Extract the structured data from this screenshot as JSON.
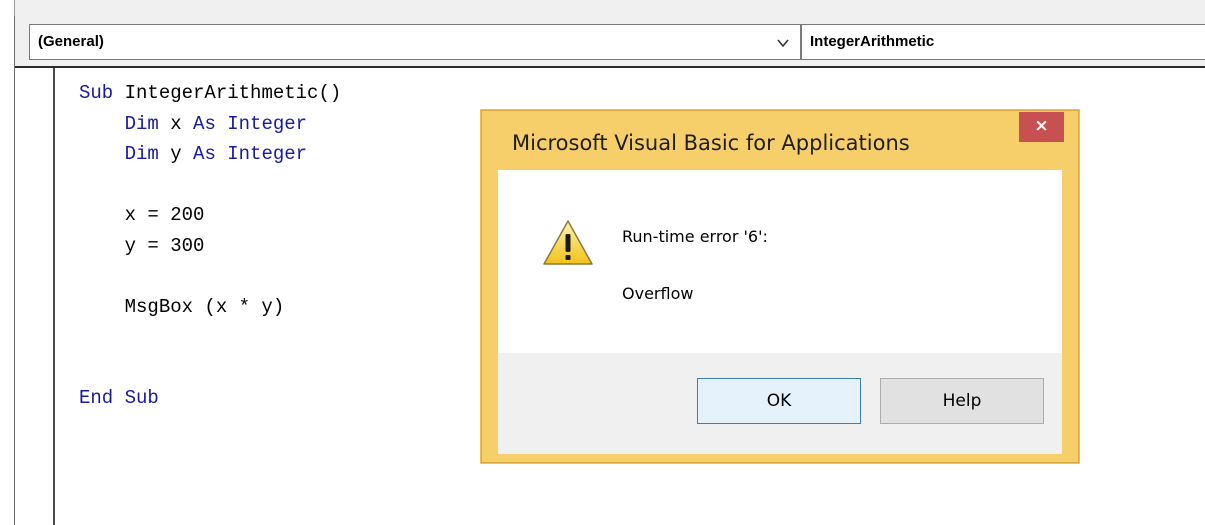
{
  "toolbar": {
    "object_combo": "(General)",
    "procedure_combo": "IntegerArithmetic"
  },
  "code": {
    "lines": [
      {
        "kw": "Sub",
        "rest": " IntegerArithmetic()"
      },
      {
        "indent": "    ",
        "kw": "Dim",
        "mid": " x ",
        "kw2": "As Integer"
      },
      {
        "indent": "    ",
        "kw": "Dim",
        "mid": " y ",
        "kw2": "As Integer"
      },
      {},
      {
        "text": "    x = 200"
      },
      {
        "text": "    y = 300"
      },
      {},
      {
        "text": "    MsgBox (x * y)"
      },
      {},
      {},
      {
        "kw": "End Sub"
      }
    ]
  },
  "dialog": {
    "title": "Microsoft Visual Basic for Applications",
    "close_label": "×",
    "error_text": "Run-time error '6':",
    "detail_text": "Overflow",
    "ok_label": "OK",
    "help_label": "Help",
    "accent_color": "#f6cf6a",
    "close_color": "#c75050",
    "icon": "warning-icon"
  }
}
